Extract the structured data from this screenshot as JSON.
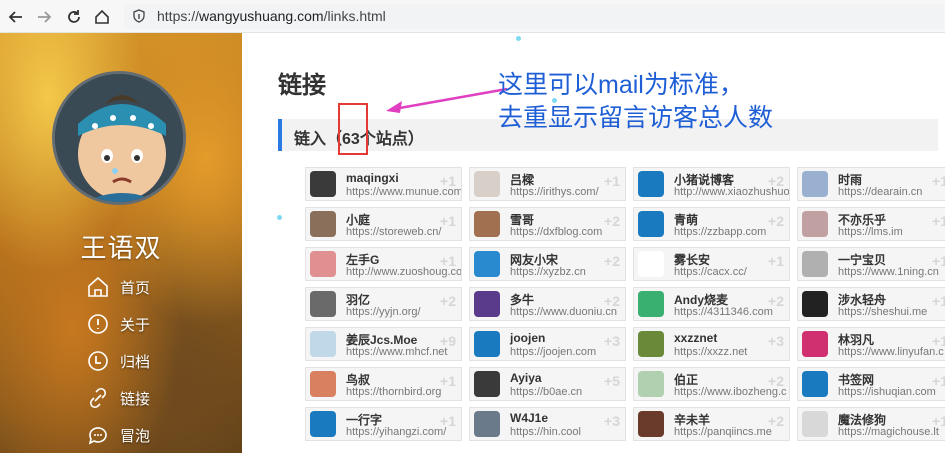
{
  "browser": {
    "url_scheme": "https://",
    "url_host": "wangyushuang.com",
    "url_path": "/links.html"
  },
  "sidebar": {
    "site_name": "王语双",
    "menu": [
      {
        "label": "首页",
        "icon": "home-icon"
      },
      {
        "label": "关于",
        "icon": "info-icon"
      },
      {
        "label": "归档",
        "icon": "archive-clock-icon"
      },
      {
        "label": "链接",
        "icon": "link-icon"
      },
      {
        "label": "冒泡",
        "icon": "chat-bubble-icon"
      }
    ]
  },
  "main": {
    "title": "链接",
    "section_prefix": "链入（",
    "section_count": "63",
    "section_suffix": "个站点）",
    "annotation_line1": "这里可以mail为标准，",
    "annotation_line2": "去重显示留言访客总人数",
    "accent_color": "#2a7ae2",
    "annotation_color": "#1f5fd6"
  },
  "links": [
    [
      {
        "name": "maqingxi",
        "url": "https://www.munue.com",
        "plus": "+1"
      },
      {
        "name": "小庭",
        "url": "https://storeweb.cn/",
        "plus": "+1"
      },
      {
        "name": "左手G",
        "url": "http://www.zuoshoug.com",
        "plus": "+1"
      },
      {
        "name": "羽亿",
        "url": "https://yyjn.org/",
        "plus": "+2"
      },
      {
        "name": "姜辰Jcs.Moe",
        "url": "https://www.mhcf.net",
        "plus": "+9"
      },
      {
        "name": "鸟叔",
        "url": "https://thornbird.org",
        "plus": "+1"
      },
      {
        "name": "一行字",
        "url": "https://yihangzi.com/",
        "plus": "+1"
      }
    ],
    [
      {
        "name": "吕樑",
        "url": "https://irithys.com/",
        "plus": "+1"
      },
      {
        "name": "雪哥",
        "url": "https://dxfblog.com",
        "plus": "+2"
      },
      {
        "name": "网友小宋",
        "url": "https://xyzbz.cn",
        "plus": "+2"
      },
      {
        "name": "多牛",
        "url": "https://www.duoniu.cn",
        "plus": "+2"
      },
      {
        "name": "joojen",
        "url": "https://joojen.com",
        "plus": "+3"
      },
      {
        "name": "Ayiya",
        "url": "https://b0ae.cn",
        "plus": "+5"
      },
      {
        "name": "W4J1e",
        "url": "https://hin.cool",
        "plus": "+3"
      }
    ],
    [
      {
        "name": "小猪说博客",
        "url": "http://www.xiaozhushuo",
        "plus": "+2"
      },
      {
        "name": "青萌",
        "url": "https://zzbapp.com",
        "plus": "+2"
      },
      {
        "name": "雾长安",
        "url": "https://cacx.cc/",
        "plus": "+1"
      },
      {
        "name": "Andy烧麦",
        "url": "https://4311346.com",
        "plus": "+2"
      },
      {
        "name": "xxzznet",
        "url": "https://xxzz.net",
        "plus": "+3"
      },
      {
        "name": "伯正",
        "url": "https://www.ibozheng.c",
        "plus": "+2"
      },
      {
        "name": "辛未羊",
        "url": "https://panqiincs.me",
        "plus": "+2"
      }
    ],
    [
      {
        "name": "时雨",
        "url": "https://dearain.cn",
        "plus": "+1"
      },
      {
        "name": "不亦乐乎",
        "url": "https://lms.im",
        "plus": "+1"
      },
      {
        "name": "一宁宝贝",
        "url": "https://www.1ning.cn",
        "plus": "+1"
      },
      {
        "name": "涉水轻舟",
        "url": "https://sheshui.me",
        "plus": "+1"
      },
      {
        "name": "林羽凡",
        "url": "https://www.linyufan.c",
        "plus": "+1"
      },
      {
        "name": "书签网",
        "url": "https://ishuqian.com",
        "plus": "+1"
      },
      {
        "name": "魔法修狗",
        "url": "https://magichouse.lt",
        "plus": "+1"
      }
    ]
  ]
}
